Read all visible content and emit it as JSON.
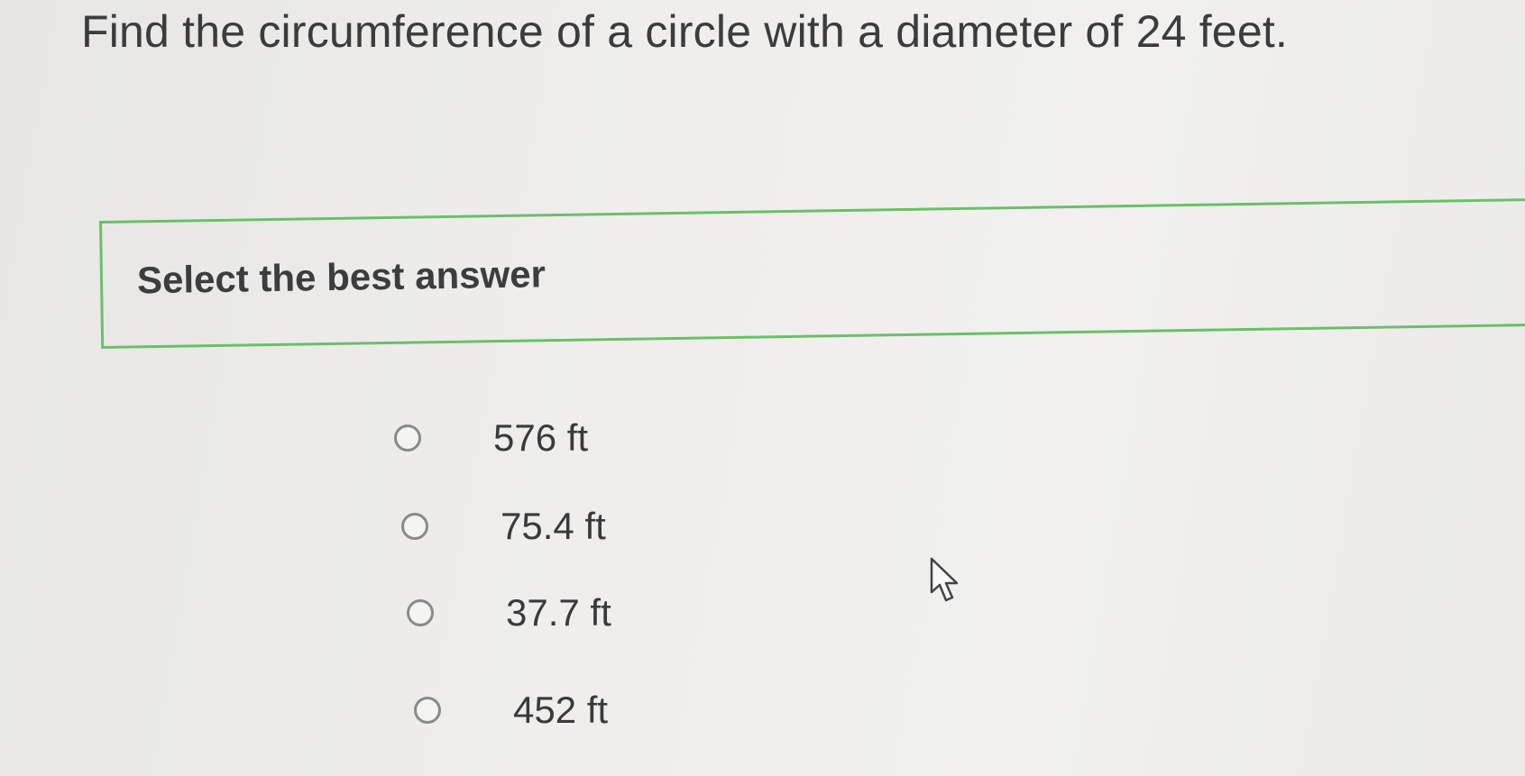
{
  "question": {
    "text": "Find the circumference of a circle with a diameter of 24 feet."
  },
  "prompt": {
    "text": "Select the best answer"
  },
  "options": [
    {
      "label": "576 ft",
      "icon": "radio-unselected-icon"
    },
    {
      "label": "75.4 ft",
      "icon": "radio-unselected-icon"
    },
    {
      "label": "37.7 ft",
      "icon": "radio-unselected-icon"
    },
    {
      "label": "452 ft",
      "icon": "radio-unselected-icon"
    }
  ],
  "colors": {
    "prompt_border": "#6bbf6a",
    "text": "#3a3a3a",
    "radio_border": "#8a8a8a"
  },
  "cursor": {
    "icon": "mouse-pointer-icon"
  }
}
